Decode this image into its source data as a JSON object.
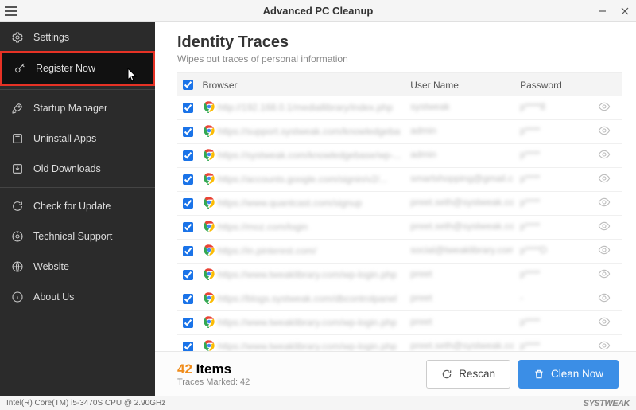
{
  "app": {
    "title": "Advanced PC Cleanup"
  },
  "sidebar": {
    "items": [
      {
        "label": "Settings"
      },
      {
        "label": "Register Now"
      },
      {
        "label": "Startup Manager"
      },
      {
        "label": "Uninstall Apps"
      },
      {
        "label": "Old Downloads"
      },
      {
        "label": "Check for Update"
      },
      {
        "label": "Technical Support"
      },
      {
        "label": "Website"
      },
      {
        "label": "About Us"
      }
    ]
  },
  "main": {
    "title": "Identity Traces",
    "subtitle": "Wipes out traces of personal information",
    "columns": {
      "browser": "Browser",
      "user": "User Name",
      "pwd": "Password"
    },
    "rows": [
      {
        "site": "http://192.168.0.1/mediallibrary/index.php",
        "user": "systweak",
        "pwd": "p****8"
      },
      {
        "site": "https://support.systweak.com/knowledgebase...",
        "user": "admin",
        "pwd": "p****"
      },
      {
        "site": "https://systweak.com/knowledgebase/wp-...",
        "user": "admin",
        "pwd": "p****"
      },
      {
        "site": "https://accounts.google.com/signin/v2/...",
        "user": "smartshopping@gmail.com",
        "pwd": "p****"
      },
      {
        "site": "https://www.quantcast.com/signup",
        "user": "preet.seth@systweak.com",
        "pwd": "p****"
      },
      {
        "site": "https://moz.com/login",
        "user": "preet.seth@systweak.com",
        "pwd": "p****"
      },
      {
        "site": "https://in.pinterest.com/",
        "user": "social@tweaklibrary.com",
        "pwd": "p****D"
      },
      {
        "site": "https://www.tweaklibrary.com/wp-login.php",
        "user": "preet",
        "pwd": "p****"
      },
      {
        "site": "https://blogs.systweak.com/dbcontrolpanel",
        "user": "preet",
        "pwd": "-"
      },
      {
        "site": "https://www.tweaklibrary.com/wp-login.php",
        "user": "preet",
        "pwd": "p****"
      },
      {
        "site": "https://www.tweaklibrary.com/wp-login.php",
        "user": "preet.seth@systweak.com",
        "pwd": "p****"
      }
    ],
    "footer": {
      "count": "42",
      "items_label": "Items",
      "marked": "Traces Marked: 42",
      "rescan": "Rescan",
      "clean": "Clean Now"
    }
  },
  "status": {
    "cpu": "Intel(R) Core(TM) i5-3470S CPU @ 2.90GHz",
    "brand": "SYSTWEAK"
  }
}
